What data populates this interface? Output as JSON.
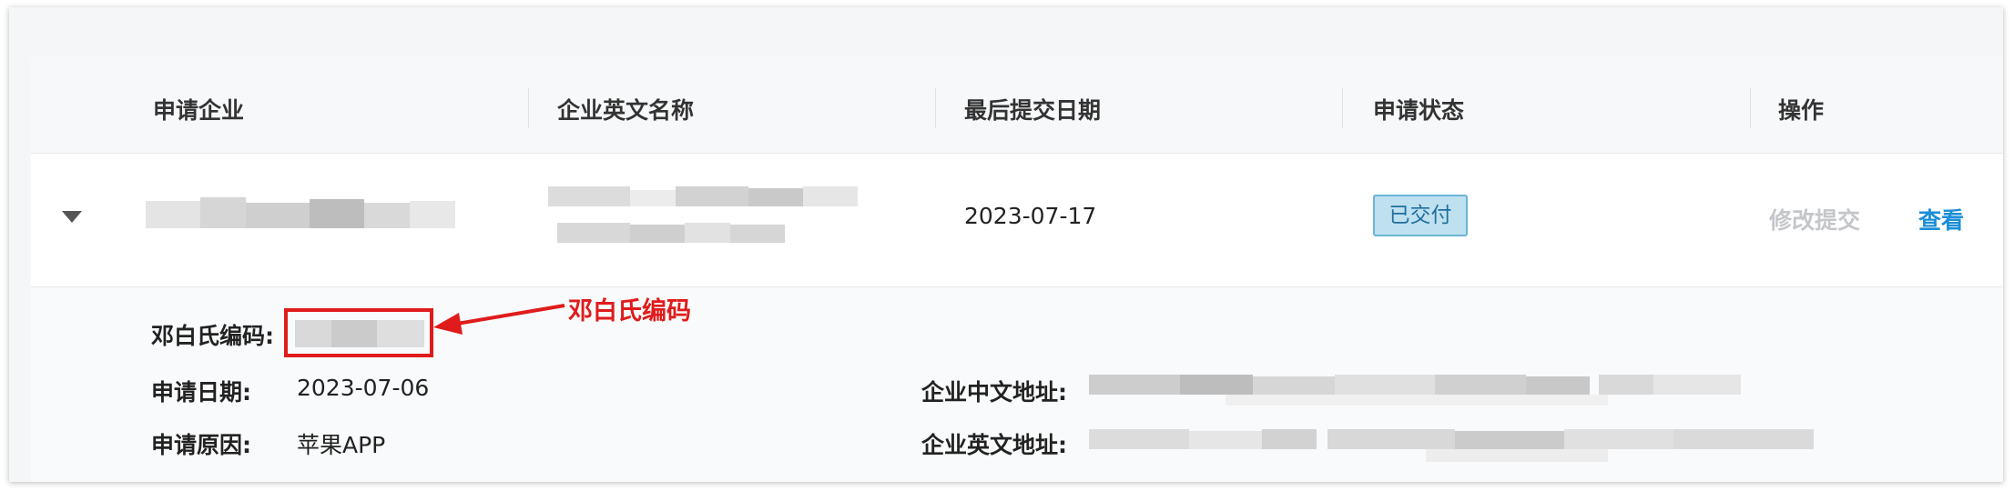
{
  "table": {
    "columns": [
      "申请企业",
      "企业英文名称",
      "最后提交日期",
      "申请状态",
      "操作"
    ]
  },
  "row": {
    "submit_date": "2023-07-17",
    "status_badge": "已交付",
    "actions": {
      "modify": "修改提交",
      "view": "查看"
    }
  },
  "detail": {
    "duns_label": "邓白氏编码:",
    "apply_date_label": "申请日期:",
    "apply_date_value": "2023-07-06",
    "apply_reason_label": "申请原因:",
    "apply_reason_value": "苹果APP",
    "cn_address_label": "企业中文地址:",
    "en_address_label": "企业英文地址:"
  },
  "annotation": {
    "text": "邓白氏编码",
    "color": "#e01b1b"
  },
  "colors": {
    "link": "#1a8ed8",
    "badge_bg": "#bfe0ef",
    "badge_border": "#6bb4d4",
    "disabled": "#c4c6ca"
  },
  "icons": {
    "expand": "caret-down-icon",
    "annotation_arrow": "red-arrow-icon"
  }
}
